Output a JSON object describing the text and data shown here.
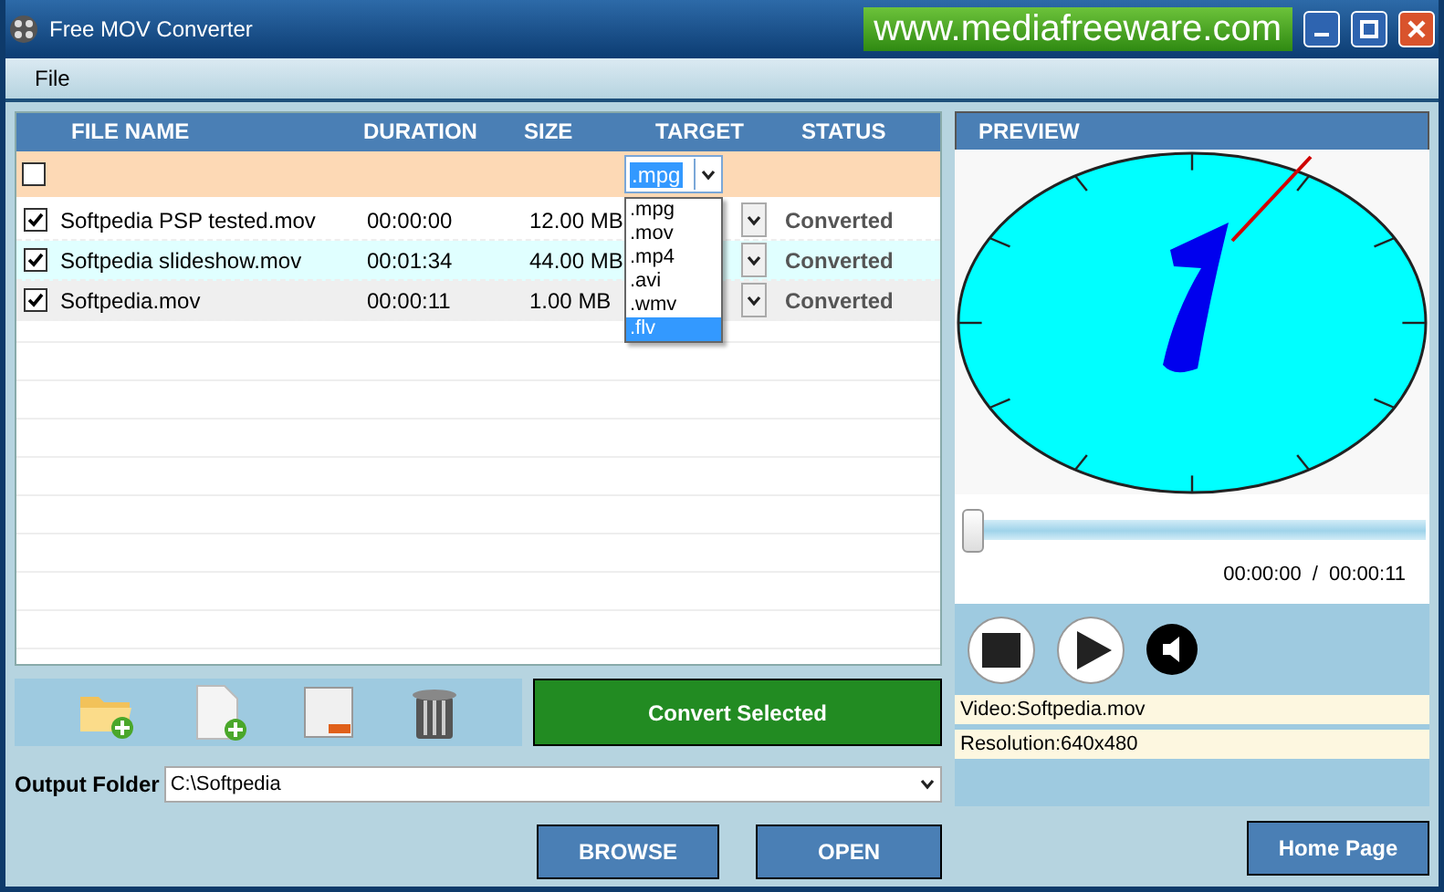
{
  "window": {
    "title": "Free MOV Converter",
    "banner": "www.mediafreeware.com"
  },
  "menu": [
    "File"
  ],
  "table": {
    "columns": [
      "FILE NAME",
      "DURATION",
      "SIZE",
      "TARGET",
      "STATUS"
    ],
    "select_all": {
      "checked": false,
      "target": ".mpg",
      "options": [
        {
          "label": ".mpg",
          "selected": false
        },
        {
          "label": ".mov",
          "selected": false
        },
        {
          "label": ".mp4",
          "selected": false
        },
        {
          "label": ".avi",
          "selected": false
        },
        {
          "label": ".wmv",
          "selected": false
        },
        {
          "label": ".flv",
          "selected": true
        }
      ]
    },
    "rows": [
      {
        "checked": true,
        "name": "Softpedia PSP tested.mov",
        "duration": "00:00:00",
        "size": "12.00 MB",
        "status": "Converted"
      },
      {
        "checked": true,
        "name": "Softpedia slideshow.mov",
        "duration": "00:01:34",
        "size": "44.00 MB",
        "status": "Converted"
      },
      {
        "checked": true,
        "name": "Softpedia.mov",
        "duration": "00:00:11",
        "size": "1.00 MB",
        "status": "Converted"
      }
    ]
  },
  "convert_button": "Convert Selected",
  "output": {
    "label": "Output Folder",
    "value": "C:\\Softpedia"
  },
  "buttons": [
    "BROWSE",
    "OPEN"
  ],
  "preview": {
    "title": "PREVIEW",
    "seek": {
      "level": 0
    },
    "current_time": "00:00:00",
    "separator": "/",
    "total_time": "00:00:11",
    "info": [
      "Video:Softpedia.mov",
      "Resolution:640x480"
    ]
  },
  "home_button": "Home Page"
}
